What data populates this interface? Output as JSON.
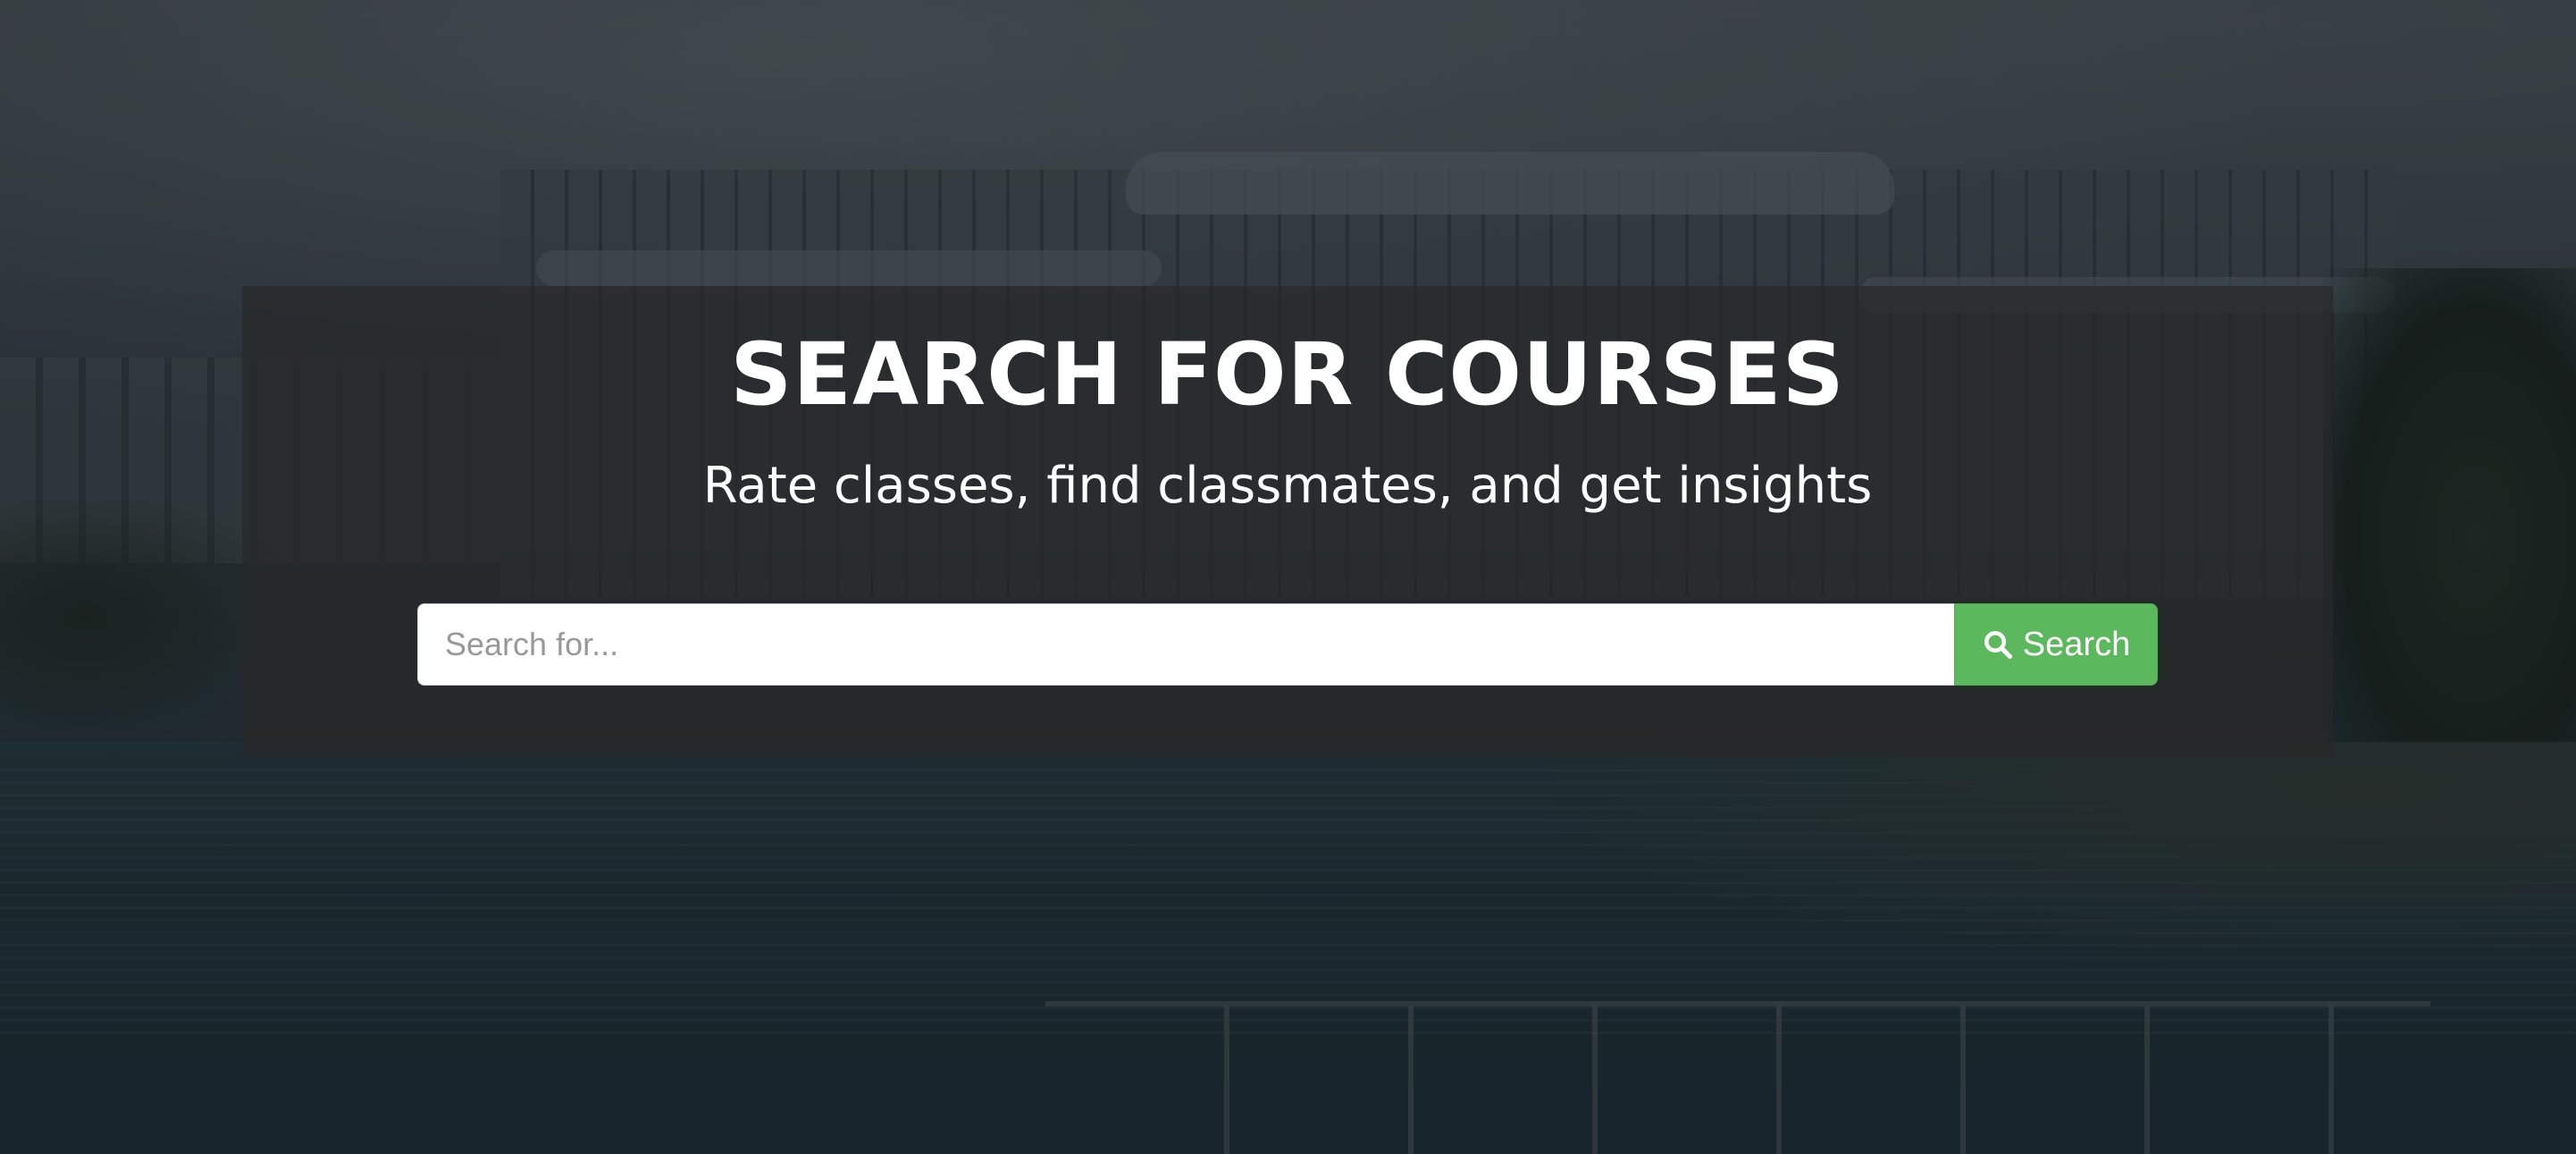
{
  "hero": {
    "background_image": "campus building by lake at dusk",
    "title": "SEARCH FOR COURSES",
    "subtitle": "Rate classes, find classmates, and get insights"
  },
  "search": {
    "placeholder": "Search for...",
    "value": "",
    "button_label": "Search",
    "button_icon": "search-icon",
    "button_color": "#5cb85c"
  },
  "colors": {
    "panel_overlay": "rgba(40,40,40,0.72)",
    "text": "#ffffff"
  }
}
